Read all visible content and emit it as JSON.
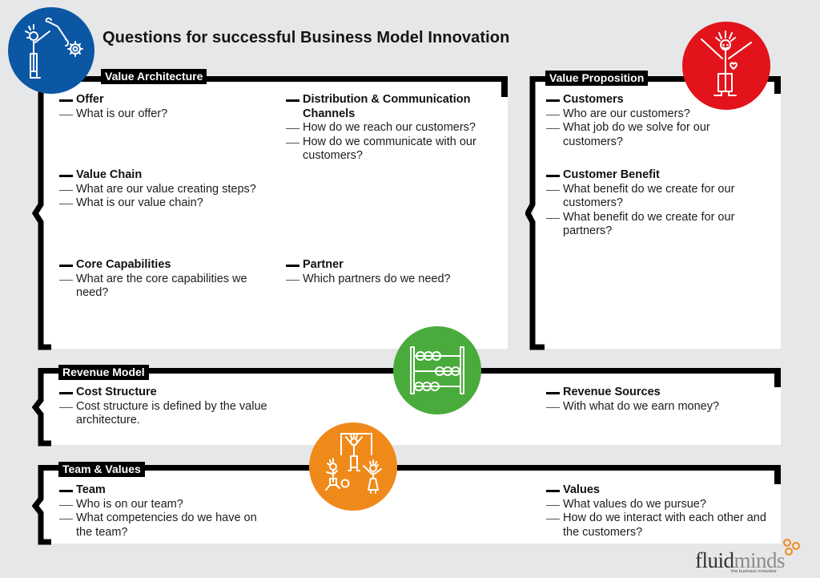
{
  "title": "Questions for successful Business Model Innovation",
  "colors": {
    "blue": "#0b57a4",
    "red": "#e2131b",
    "green": "#49ab3b",
    "orange": "#ef8a1a",
    "background": "#e6e7e9",
    "logo_accent": "#ef8a1a"
  },
  "sections": {
    "value_architecture": {
      "label": "Value Architecture",
      "icon": "engineer-wrench-gear-icon",
      "blocks": [
        {
          "heading": "Offer",
          "questions": [
            "What is our offer?"
          ]
        },
        {
          "heading": "Distribution & Communication Channels",
          "questions": [
            "How do we reach our customers?",
            "How do we communicate with our customers?"
          ]
        },
        {
          "heading": "Value Chain",
          "questions": [
            "What are our value creating steps?",
            "What is our value chain?"
          ]
        },
        {
          "heading": "Core Capabilities",
          "questions": [
            "What are the core capabilities we need?"
          ]
        },
        {
          "heading": "Partner",
          "questions": [
            "Which partners do we need?"
          ]
        }
      ]
    },
    "value_proposition": {
      "label": "Value Proposition",
      "icon": "happy-person-heart-icon",
      "blocks": [
        {
          "heading": "Customers",
          "questions": [
            "Who are our customers?",
            "What job do we solve for our customers?"
          ]
        },
        {
          "heading": "Customer Benefit",
          "questions": [
            "What benefit do we create for our customers?",
            "What benefit do we create for our partners?"
          ]
        }
      ]
    },
    "revenue_model": {
      "label": "Revenue Model",
      "icon": "abacus-icon",
      "blocks": [
        {
          "heading": "Cost Structure",
          "questions": [
            "Cost structure is defined by the value architecture."
          ]
        },
        {
          "heading": "Revenue Sources",
          "questions": [
            "With what do we earn money?"
          ]
        }
      ]
    },
    "team_values": {
      "label": "Team & Values",
      "icon": "team-playing-icon",
      "blocks": [
        {
          "heading": "Team",
          "questions": [
            "Who is on our team?",
            "What competencies do we have on the team?"
          ]
        },
        {
          "heading": "Values",
          "questions": [
            "What values do we pursue?",
            "How do we interact with each other and the customers?"
          ]
        }
      ]
    }
  },
  "logo": {
    "part1": "fluid",
    "part2": "minds",
    "tagline": "the business innovator",
    "icon": "propeller-knot-icon"
  }
}
